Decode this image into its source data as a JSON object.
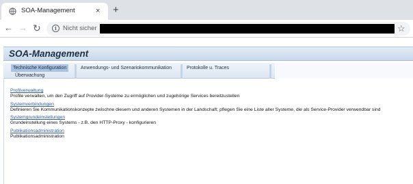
{
  "browser": {
    "tab_title": "SOA-Management",
    "new_tab_symbol": "+",
    "close_symbol": "×",
    "security_label": "Nicht sicher"
  },
  "app": {
    "title": "SOA-Management",
    "tabs": [
      "Technische Konfiguration",
      "Anwendungs- und Szenariokommunikation",
      "Protokolle u. Traces",
      "Überwachung"
    ],
    "items": [
      {
        "link": "Profilverwaltung",
        "description": "Profile verwalten, um den Zugriff auf Provider-Systeme zu ermöglichen und zugehörige Services bereitzustellen"
      },
      {
        "link": "Systemverbindungen",
        "description": "Definieren Sie Kommunikationskonzepte zwischne diesem und anderen Systemen in der Landschaft; pflegen Sie eine Liste aller Systeme, die als Service-Provider verwendbar sind"
      },
      {
        "link": "Systemgrundeinstellungen",
        "description": "Grundeinstellung eines Systems - z.B. den HTTP-Proxy - konfigurieren"
      },
      {
        "link": "Publikationsadministration",
        "description": "Publikationsadministration"
      }
    ]
  },
  "colors": {
    "link": "#2b5caa",
    "active_tab": "#a9c3e0",
    "header_band": "#c9d9ea"
  }
}
